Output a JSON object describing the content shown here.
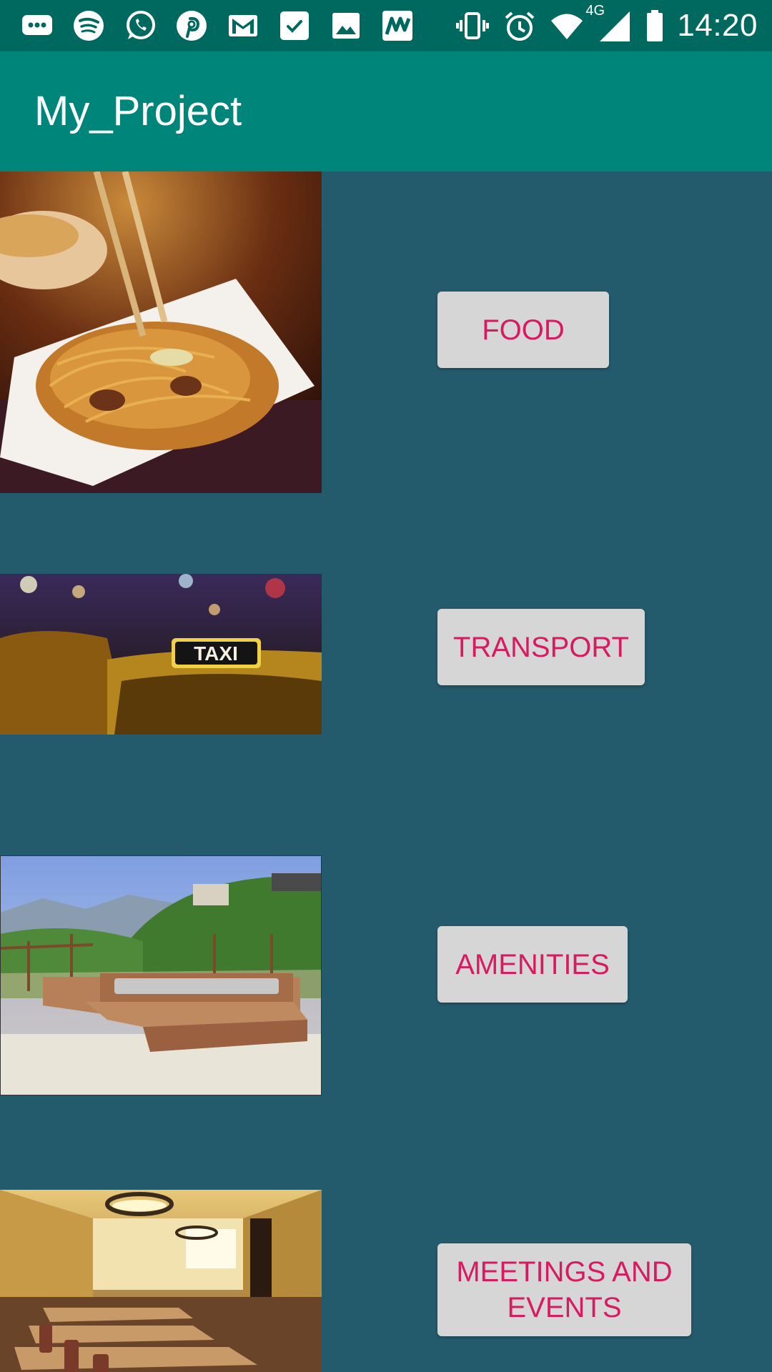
{
  "status_bar": {
    "time": "14:20",
    "network": "4G",
    "notification_icons": [
      "chat-bubble-icon",
      "spotify-icon",
      "whatsapp-icon",
      "pinterest-icon",
      "gmail-icon",
      "tasks-icon",
      "gallery-icon",
      "maps-app-icon"
    ],
    "system_icons": [
      "vibrate-icon",
      "alarm-icon",
      "wifi-icon",
      "cellular-signal-icon",
      "battery-icon"
    ]
  },
  "app_bar": {
    "title": "My_Project"
  },
  "categories": [
    {
      "label": "FOOD",
      "image": "noodles-photo"
    },
    {
      "label": "TRANSPORT",
      "image": "taxi-photo"
    },
    {
      "label": "AMENITIES",
      "image": "hot-tub-deck-photo"
    },
    {
      "label": "MEETINGS AND EVENTS",
      "image": "conference-room-photo"
    }
  ],
  "colors": {
    "status_bar": "#00695f",
    "app_bar": "#00857a",
    "background": "#235a6c",
    "button_bg": "#d6d6d6",
    "button_text": "#d81b60"
  },
  "image_texts": {
    "taxi_sign": "TAXI"
  }
}
